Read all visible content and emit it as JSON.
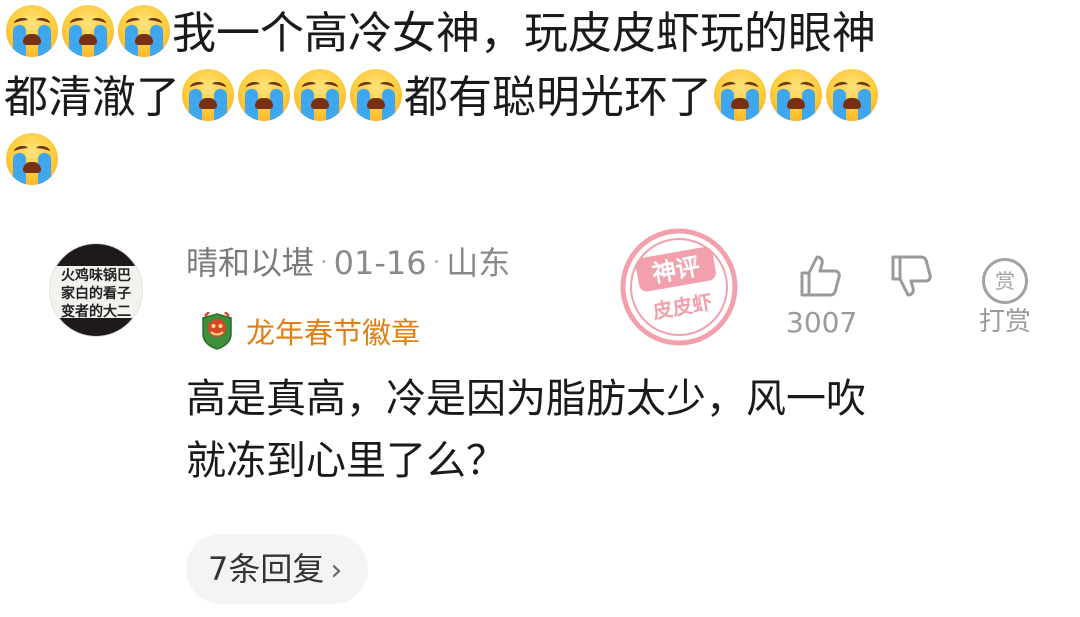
{
  "post": {
    "line1": "我一个高冷女神，玩皮皮虾玩的眼神",
    "line2a": "都清澈了",
    "line2b": "都有聪明光环了",
    "emoji_icon": "loudly-crying-face-icon"
  },
  "comment": {
    "avatar": {
      "line1": "火鸡味锅巴",
      "line2": "家白的看子",
      "line3": "变者的大二"
    },
    "username": "晴和以堪",
    "date": "01-16",
    "location": "山东",
    "badge": {
      "label": "龙年春节徽章",
      "icon": "dragon-badge-icon"
    },
    "text_line1": "高是真高，冷是因为脂肪太少，风一吹",
    "text_line2": "就冻到心里了么？",
    "replies_label": "7条回复",
    "watermark": {
      "top": "神评",
      "bottom": "皮皮虾"
    }
  },
  "actions": {
    "like_count": "3007",
    "reward_icon_text": "赏",
    "reward_label": "打赏"
  },
  "colors": {
    "badge": "#e07f14",
    "meta": "#8a8a8a",
    "watermark": "#e8546a"
  }
}
